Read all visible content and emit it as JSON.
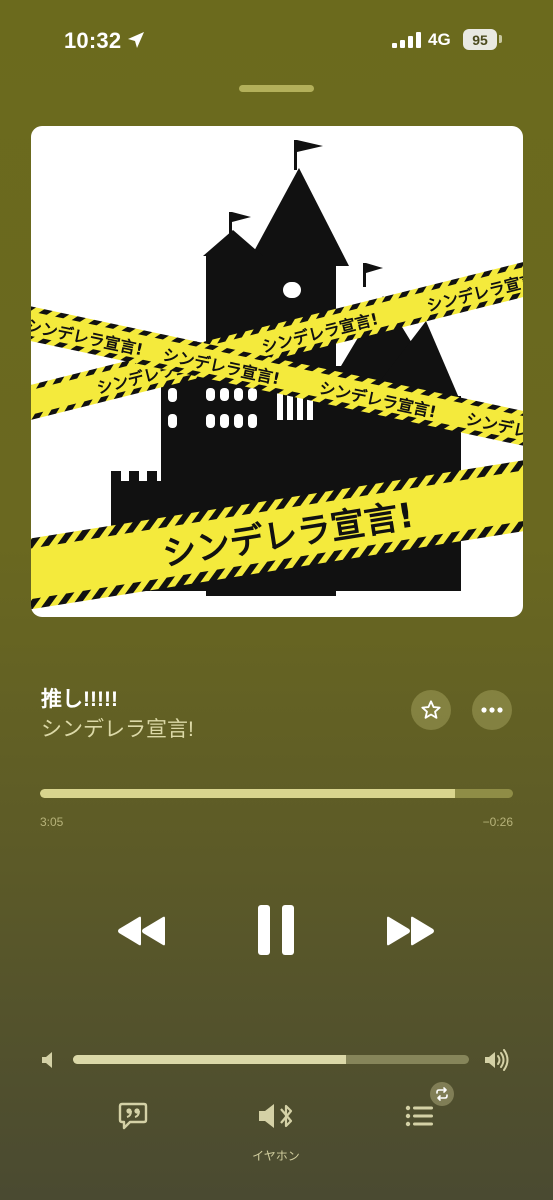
{
  "status_bar": {
    "time": "10:32",
    "network": "4G",
    "battery": "95",
    "icons": [
      "location-arrow-icon",
      "signal-bars-icon",
      "battery-icon"
    ]
  },
  "track": {
    "title": "推し!!!!!",
    "artist": "シンデレラ宣言!",
    "artwork_caption": "シンデレラ宣言!"
  },
  "progress": {
    "elapsed": "3:05",
    "remaining": "−0:26",
    "fraction": 0.877
  },
  "volume": {
    "fraction": 0.69
  },
  "output": {
    "label": "イヤホン"
  },
  "colors": {
    "background": "#6b6a1d",
    "tape_yellow": "#f4ea3c",
    "accent_light": "#d9d58e"
  }
}
